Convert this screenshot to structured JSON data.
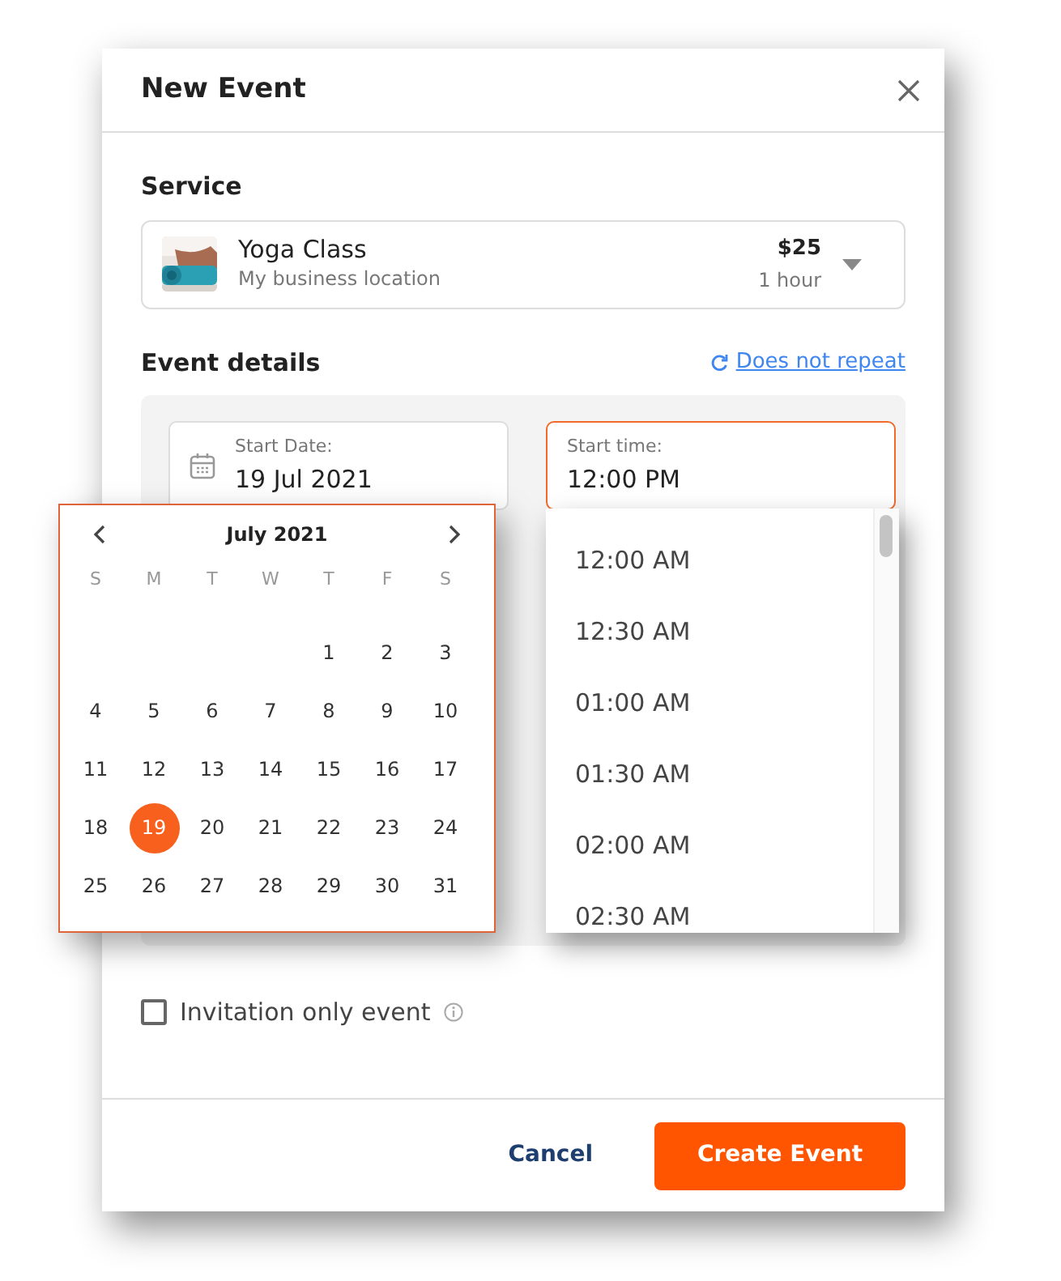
{
  "dialog": {
    "title": "New Event"
  },
  "service": {
    "label": "Service",
    "name": "Yoga Class",
    "location": "My business location",
    "price": "$25",
    "duration": "1 hour"
  },
  "event_details": {
    "label": "Event details",
    "repeat_link": "Does not repeat",
    "start_date": {
      "label": "Start Date:",
      "value": "19 Jul 2021"
    },
    "start_time": {
      "label": "Start time:",
      "value": "12:00 PM",
      "expanded": true
    }
  },
  "calendar": {
    "month": "July 2021",
    "weekdays": [
      "S",
      "M",
      "T",
      "W",
      "T",
      "F",
      "S"
    ],
    "weeks": [
      [
        {
          "text": "1",
          "selected": false
        },
        {
          "text": "2",
          "selected": false
        },
        {
          "text": "3",
          "selected": false
        }
      ],
      [
        {
          "text": "4",
          "selected": false
        },
        {
          "text": "5",
          "selected": false
        },
        {
          "text": "6",
          "selected": false
        },
        {
          "text": "7",
          "selected": false
        },
        {
          "text": "8",
          "selected": false
        },
        {
          "text": "9",
          "selected": false
        },
        {
          "text": "10",
          "selected": false
        }
      ],
      [
        {
          "text": "11",
          "selected": false
        },
        {
          "text": "12",
          "selected": false
        },
        {
          "text": "13",
          "selected": false
        },
        {
          "text": "14",
          "selected": false
        },
        {
          "text": "15",
          "selected": false
        },
        {
          "text": "16",
          "selected": false
        },
        {
          "text": "17",
          "selected": false
        }
      ],
      [
        {
          "text": "18",
          "selected": false
        },
        {
          "text": "19",
          "selected": true
        },
        {
          "text": "20",
          "selected": false
        },
        {
          "text": "21",
          "selected": false
        },
        {
          "text": "22",
          "selected": false
        },
        {
          "text": "23",
          "selected": false
        },
        {
          "text": "24",
          "selected": false
        }
      ],
      [
        {
          "text": "25",
          "selected": false
        },
        {
          "text": "26",
          "selected": false
        },
        {
          "text": "27",
          "selected": false
        },
        {
          "text": "28",
          "selected": false
        },
        {
          "text": "29",
          "selected": false
        },
        {
          "text": "30",
          "selected": false
        },
        {
          "text": "31",
          "selected": false
        }
      ]
    ]
  },
  "time_options": [
    "12:00 AM",
    "12:30 AM",
    "01:00 AM",
    "01:30 AM",
    "02:00 AM",
    "02:30 AM"
  ],
  "invitation_only": {
    "label": "Invitation only event",
    "checked": false
  },
  "buttons": {
    "cancel": "Cancel",
    "create": "Create Event"
  }
}
